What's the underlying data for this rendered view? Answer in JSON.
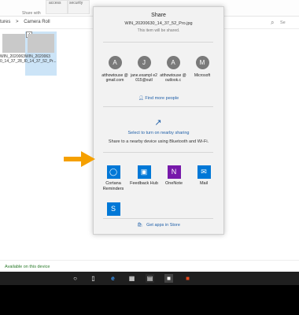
{
  "ribbon": {
    "quick_access_label": "access",
    "security_label": "security",
    "group_label": "Share with"
  },
  "address": {
    "crumbs": [
      "tures",
      ">",
      "Camera Roll"
    ],
    "search_placeholder": "Se"
  },
  "files": [
    {
      "caption": "WIN_2020063 0_14_37_28_Pr..."
    },
    {
      "caption": "WIN_2020063 0_14_37_52_Pr..."
    }
  ],
  "status": {
    "text": "Available on this device"
  },
  "share": {
    "title": "Share",
    "file_name": "WIN_20200630_14_37_52_Pro.jpg",
    "note": "This item will be shared.",
    "contacts": [
      {
        "initial": "A",
        "name": "atthowtouse @gmail.com"
      },
      {
        "initial": "J",
        "name": "jane.exampl e2015@outl"
      },
      {
        "initial": "A",
        "name": "atthowtouse @outlook.c"
      },
      {
        "initial": "M",
        "name": "Microsoft"
      }
    ],
    "find_more": "Find more people",
    "nearby_title": "Select to turn on nearby sharing",
    "nearby_sub": "Share to a nearby device using Bluetooth and Wi-Fi.",
    "apps": [
      {
        "name": "Cortana Reminders",
        "icon": "cortana-icon",
        "color": "#0078d7"
      },
      {
        "name": "Feedback Hub",
        "icon": "feedback-hub-icon",
        "color": "#0078d7"
      },
      {
        "name": "OneNote",
        "icon": "onenote-icon",
        "color": "#7719aa"
      },
      {
        "name": "Mail",
        "icon": "mail-icon",
        "color": "#0078d7"
      },
      {
        "name": "",
        "icon": "skype-icon",
        "color": "#0078d7"
      }
    ],
    "store_link": "Get apps in Store"
  },
  "colors": {
    "accent": "#1f5fa8",
    "arrow": "#f5a000",
    "taskbar": "#1f1f1f"
  },
  "taskbar_icons": [
    "cortana-circle-icon",
    "task-view-icon",
    "edge-icon",
    "store-icon",
    "phone-icon",
    "office-icon"
  ]
}
